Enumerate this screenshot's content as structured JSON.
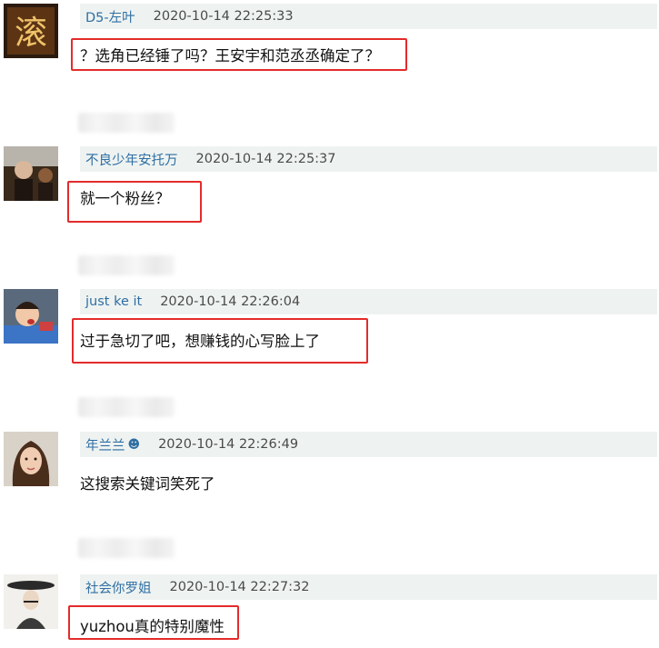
{
  "comments": [
    {
      "user": "D5-左叶",
      "time": "2020-10-14 22:25:33",
      "text": "？选角已经锤了吗？王安宇和范丞丞确定了？",
      "avatar_glyph": "滚"
    },
    {
      "user": "不良少年安托万",
      "time": "2020-10-14 22:25:37",
      "text": "就一个粉丝？"
    },
    {
      "user": "just ke it",
      "time": "2020-10-14 22:26:04",
      "text": "过于急切了吧，想赚钱的心写脸上了"
    },
    {
      "user": "年兰兰",
      "badge": "☻",
      "time": "2020-10-14 22:26:49",
      "text": "这搜索关键词笑死了"
    },
    {
      "user": "社会你罗姐",
      "time": "2020-10-14 22:27:32",
      "text": "yuzhou真的特别魔性"
    }
  ],
  "colors": {
    "highlight": "#e42b2b",
    "username": "#2f6ea3",
    "meta_bg": "#eef3f1"
  }
}
